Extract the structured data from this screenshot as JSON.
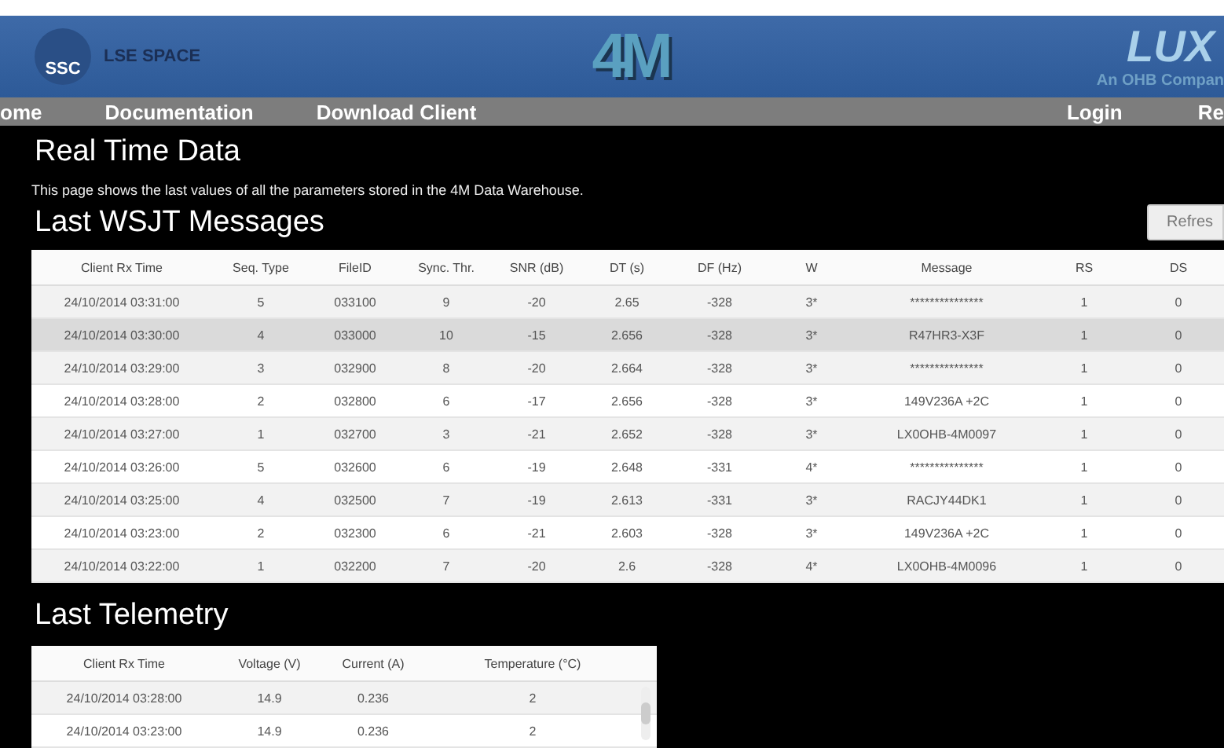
{
  "header": {
    "org_logo": "SSC",
    "org_name": "LSE SPACE",
    "center_logo": "4M",
    "partner_logo": "LUX",
    "partner_tagline": "An OHB Compan"
  },
  "nav": {
    "left": [
      "ome",
      "Documentation",
      "Download Client"
    ],
    "right": [
      "Login",
      "Re"
    ]
  },
  "page_title": "Real Time Data",
  "description": "This page shows the last values of all the parameters stored in the 4M Data Warehouse.",
  "wsjt": {
    "title": "Last WSJT Messages",
    "refresh_button": "Refres",
    "columns": [
      "Client Rx Time",
      "Seq. Type",
      "FileID",
      "Sync. Thr.",
      "SNR (dB)",
      "DT (s)",
      "DF (Hz)",
      "W",
      "Message",
      "RS",
      "DS"
    ],
    "rows": [
      {
        "selected": false,
        "cells": [
          "24/10/2014 03:31:00",
          "5",
          "033100",
          "9",
          "-20",
          "2.65",
          "-328",
          "3*",
          "***************",
          "1",
          "0"
        ]
      },
      {
        "selected": true,
        "cells": [
          "24/10/2014 03:30:00",
          "4",
          "033000",
          "10",
          "-15",
          "2.656",
          "-328",
          "3*",
          "R47HR3-X3F",
          "1",
          "0"
        ]
      },
      {
        "selected": false,
        "cells": [
          "24/10/2014 03:29:00",
          "3",
          "032900",
          "8",
          "-20",
          "2.664",
          "-328",
          "3*",
          "***************",
          "1",
          "0"
        ]
      },
      {
        "selected": false,
        "cells": [
          "24/10/2014 03:28:00",
          "2",
          "032800",
          "6",
          "-17",
          "2.656",
          "-328",
          "3*",
          "149V236A  +2C",
          "1",
          "0"
        ]
      },
      {
        "selected": false,
        "cells": [
          "24/10/2014 03:27:00",
          "1",
          "032700",
          "3",
          "-21",
          "2.652",
          "-328",
          "3*",
          "LX0OHB-4M0097",
          "1",
          "0"
        ]
      },
      {
        "selected": false,
        "cells": [
          "24/10/2014 03:26:00",
          "5",
          "032600",
          "6",
          "-19",
          "2.648",
          "-331",
          "4*",
          "***************",
          "1",
          "0"
        ]
      },
      {
        "selected": false,
        "cells": [
          "24/10/2014 03:25:00",
          "4",
          "032500",
          "7",
          "-19",
          "2.613",
          "-331",
          "3*",
          "RACJY44DK1",
          "1",
          "0"
        ]
      },
      {
        "selected": false,
        "cells": [
          "24/10/2014 03:23:00",
          "2",
          "032300",
          "6",
          "-21",
          "2.603",
          "-328",
          "3*",
          "149V236A  +2C",
          "1",
          "0"
        ]
      },
      {
        "selected": false,
        "cells": [
          "24/10/2014 03:22:00",
          "1",
          "032200",
          "7",
          "-20",
          "2.6",
          "-328",
          "4*",
          "LX0OHB-4M0096",
          "1",
          "0"
        ]
      }
    ]
  },
  "telemetry": {
    "title": "Last Telemetry",
    "columns": [
      "Client Rx Time",
      "Voltage (V)",
      "Current (A)",
      "Temperature (°C)"
    ],
    "rows": [
      {
        "cells": [
          "24/10/2014 03:28:00",
          "14.9",
          "0.236",
          "2"
        ]
      },
      {
        "cells": [
          "24/10/2014 03:23:00",
          "14.9",
          "0.236",
          "2"
        ]
      }
    ]
  }
}
